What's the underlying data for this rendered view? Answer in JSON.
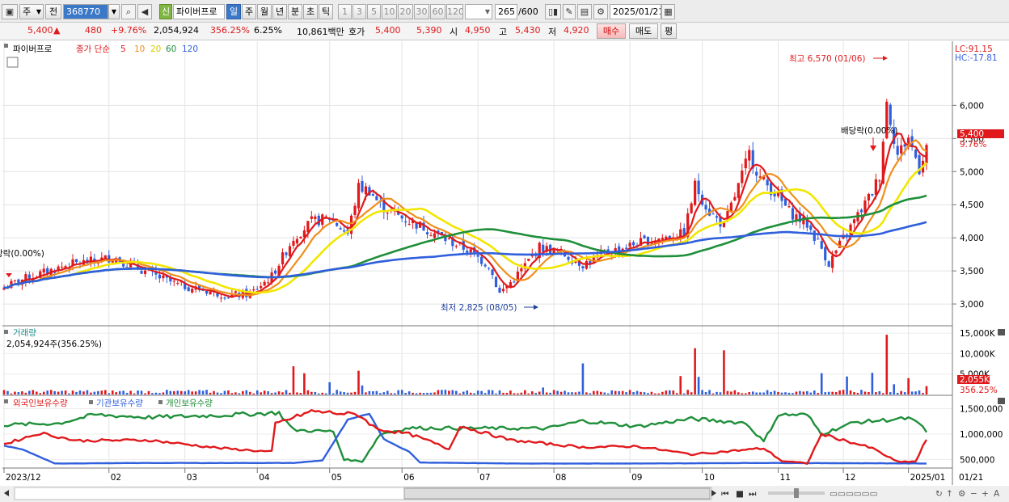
{
  "toolbar": {
    "market": "주",
    "kind": "전",
    "code": "368770",
    "name_badge": "신",
    "name": "파이버프로",
    "periods": [
      {
        "label": "일",
        "selected": true
      },
      {
        "label": "주"
      },
      {
        "label": "월"
      },
      {
        "label": "년"
      },
      {
        "label": "분"
      },
      {
        "label": "초"
      },
      {
        "label": "틱"
      }
    ],
    "counts": [
      "1",
      "3",
      "5",
      "10",
      "20",
      "30",
      "60",
      "120"
    ],
    "page": "265",
    "page_total": "/600",
    "date": "2025/01/21"
  },
  "quote": {
    "price": "5,400",
    "arrow": "▲",
    "change": "480",
    "change_pct": "+9.76%",
    "volume": "2,054,924",
    "vol_ratio": "356.25%",
    "turnover": "6.25%",
    "amount": "10,861백만",
    "hoga_label": "호가",
    "ask": "5,400",
    "bid": "5,390",
    "open_label": "시",
    "open": "4,950",
    "high_label": "고",
    "high": "5,430",
    "low_label": "저",
    "low": "4,920",
    "buy": "매수",
    "sell": "매도",
    "avg": "평"
  },
  "price_panel": {
    "name": "파이버프로",
    "legend_prefix": "종가 단순",
    "ma": [
      {
        "period": "5",
        "color": "#e0191c"
      },
      {
        "period": "10",
        "color": "#ef8f1c"
      },
      {
        "period": "20",
        "color": "#f2e600"
      },
      {
        "period": "60",
        "color": "#1f8f3a"
      },
      {
        "period": "120",
        "color": "#2f5fdc"
      }
    ],
    "lc": "LC:91.15",
    "hc": "HC:-17.81",
    "max_note": "최고 6,570 (01/06)",
    "min_note": "최저 2,825 (08/05)",
    "dividend_note": "배당락(0.00%)",
    "left_note": "당락(0.00%)",
    "current_tag": "5,400",
    "current_pct": "9.76%"
  },
  "volume_panel": {
    "title": "거래량",
    "value": "2,054,924주(356.25%)",
    "current_tag": "2,055K",
    "current_pct": "356.25%"
  },
  "holding_panel": {
    "series": [
      {
        "name": "외국인보유수량",
        "color": "#e0191c"
      },
      {
        "name": "기관보유수량",
        "color": "#2f5fdc"
      },
      {
        "name": "개인보유수량",
        "color": "#1f8f3a"
      }
    ]
  },
  "bottom": {
    "date_label": "01/21"
  },
  "chart_data": {
    "type": "candlestick",
    "x_dates": [
      "2023/12",
      "02",
      "03",
      "04",
      "05",
      "06",
      "07",
      "08",
      "09",
      "10",
      "11",
      "12",
      "2025/01"
    ],
    "price_axis": {
      "ticks": [
        3000,
        3500,
        4000,
        4500,
        5000,
        5500,
        6000
      ],
      "tick_labels": [
        "3,000",
        "3,500",
        "4,000",
        "4,500",
        "5,000",
        "5,500",
        "6,000"
      ],
      "ylim": [
        2720,
        6920
      ]
    },
    "close_anchors": [
      [
        0,
        3250
      ],
      [
        5,
        3370
      ],
      [
        12,
        3490
      ],
      [
        18,
        3600
      ],
      [
        25,
        3650
      ],
      [
        30,
        3710
      ],
      [
        35,
        3590
      ],
      [
        42,
        3420
      ],
      [
        48,
        3290
      ],
      [
        55,
        3210
      ],
      [
        62,
        3130
      ],
      [
        68,
        3150
      ],
      [
        74,
        3420
      ],
      [
        80,
        4000
      ],
      [
        85,
        4240
      ],
      [
        90,
        4300
      ],
      [
        95,
        4060
      ],
      [
        98,
        4760
      ],
      [
        101,
        4720
      ],
      [
        104,
        4490
      ],
      [
        110,
        4300
      ],
      [
        116,
        4160
      ],
      [
        122,
        3980
      ],
      [
        128,
        3820
      ],
      [
        134,
        3580
      ],
      [
        137,
        3160
      ],
      [
        141,
        3380
      ],
      [
        148,
        3860
      ],
      [
        154,
        3770
      ],
      [
        160,
        3600
      ],
      [
        166,
        3760
      ],
      [
        174,
        3900
      ],
      [
        180,
        3980
      ],
      [
        188,
        4060
      ],
      [
        191,
        4790
      ],
      [
        195,
        4390
      ],
      [
        199,
        4180
      ],
      [
        203,
        4780
      ],
      [
        206,
        5270
      ],
      [
        209,
        4900
      ],
      [
        213,
        4680
      ],
      [
        217,
        4400
      ],
      [
        222,
        4200
      ],
      [
        226,
        3840
      ],
      [
        228,
        3610
      ],
      [
        232,
        3990
      ],
      [
        236,
        4340
      ],
      [
        240,
        4690
      ],
      [
        242,
        4950
      ],
      [
        244,
        6050
      ],
      [
        247,
        5250
      ],
      [
        250,
        5520
      ],
      [
        253,
        5050
      ],
      [
        255,
        5400
      ]
    ],
    "volume_axis": {
      "ticks": [
        5000,
        10000,
        15000
      ],
      "tick_labels": [
        "5,000K",
        "10,000K",
        "15,000K"
      ],
      "ylim": [
        0,
        16000
      ]
    },
    "volume_spikes_k": [
      [
        80,
        6900
      ],
      [
        83,
        5200
      ],
      [
        90,
        3000
      ],
      [
        98,
        5800
      ],
      [
        99,
        2200
      ],
      [
        149,
        1700
      ],
      [
        160,
        7600
      ],
      [
        187,
        4500
      ],
      [
        191,
        11300
      ],
      [
        192,
        4300
      ],
      [
        199,
        10800
      ],
      [
        226,
        5200
      ],
      [
        233,
        4400
      ],
      [
        240,
        5300
      ],
      [
        244,
        14600
      ],
      [
        246,
        2500
      ],
      [
        250,
        4000
      ],
      [
        255,
        2055
      ]
    ],
    "holding_axis": {
      "ticks": [
        500000,
        1000000,
        1500000
      ],
      "tick_labels": [
        "500,000",
        "1,000,000",
        "1,500,000"
      ],
      "ylim": [
        330000,
        1700000
      ]
    },
    "holding_anchors": {
      "foreign": [
        [
          0,
          800000
        ],
        [
          10,
          1020000
        ],
        [
          20,
          870000
        ],
        [
          40,
          880000
        ],
        [
          60,
          720000
        ],
        [
          74,
          650000
        ],
        [
          75,
          1200000
        ],
        [
          85,
          1450000
        ],
        [
          98,
          1380000
        ],
        [
          103,
          1100000
        ],
        [
          112,
          1000000
        ],
        [
          118,
          850000
        ],
        [
          123,
          700000
        ],
        [
          126,
          1160000
        ],
        [
          140,
          880000
        ],
        [
          160,
          740000
        ],
        [
          175,
          760000
        ],
        [
          190,
          600000
        ],
        [
          210,
          720000
        ],
        [
          215,
          470000
        ],
        [
          222,
          420000
        ],
        [
          226,
          1000000
        ],
        [
          240,
          720000
        ],
        [
          247,
          450000
        ],
        [
          252,
          460000
        ],
        [
          255,
          900000
        ]
      ],
      "institution": [
        [
          0,
          770000
        ],
        [
          5,
          700000
        ],
        [
          14,
          420000
        ],
        [
          40,
          430000
        ],
        [
          80,
          430000
        ],
        [
          88,
          480000
        ],
        [
          95,
          1280000
        ],
        [
          101,
          1400000
        ],
        [
          105,
          900000
        ],
        [
          112,
          650000
        ],
        [
          115,
          440000
        ],
        [
          140,
          420000
        ],
        [
          180,
          420000
        ],
        [
          205,
          430000
        ],
        [
          215,
          430000
        ],
        [
          255,
          420000
        ]
      ],
      "individual": [
        [
          0,
          1180000
        ],
        [
          15,
          1210000
        ],
        [
          25,
          1380000
        ],
        [
          40,
          1330000
        ],
        [
          60,
          1370000
        ],
        [
          76,
          1420000
        ],
        [
          80,
          1080000
        ],
        [
          91,
          1050000
        ],
        [
          94,
          500000
        ],
        [
          99,
          460000
        ],
        [
          104,
          1000000
        ],
        [
          112,
          1120000
        ],
        [
          150,
          1110000
        ],
        [
          160,
          1260000
        ],
        [
          175,
          1150000
        ],
        [
          190,
          1300000
        ],
        [
          205,
          1220000
        ],
        [
          210,
          850000
        ],
        [
          214,
          1380000
        ],
        [
          222,
          1380000
        ],
        [
          226,
          1000000
        ],
        [
          235,
          1230000
        ],
        [
          250,
          1310000
        ],
        [
          254,
          1150000
        ],
        [
          255,
          1030000
        ]
      ]
    }
  }
}
